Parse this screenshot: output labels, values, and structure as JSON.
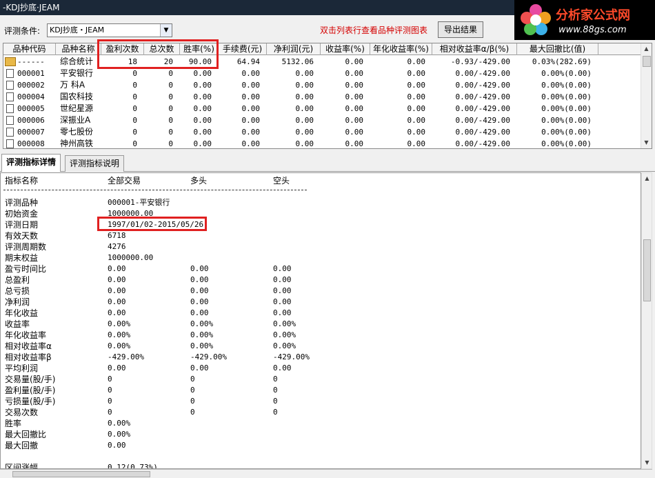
{
  "window": {
    "title": "-KDJ抄底·JEAM"
  },
  "logo": {
    "brand": "分析家公式网",
    "site": "www.88gs.com"
  },
  "toolbar": {
    "condition_label": "评测条件:",
    "condition_value": "KDJ抄底・JEAM",
    "hint": "双击列表行查看品种评测图表",
    "export_label": "导出结果"
  },
  "grid": {
    "columns": [
      "品种代码",
      "品种名称",
      "盈利次数",
      "总次数",
      "胜率(%)",
      "手续费(元)",
      "净利润(元)",
      "收益率(%)",
      "年化收益率(%)",
      "相对收益率α/β(%)",
      "最大回撤比(值)"
    ],
    "rows": [
      [
        "------",
        "综合统计",
        "18",
        "20",
        "90.00",
        "64.94",
        "5132.06",
        "0.00",
        "0.00",
        "-0.93/-429.00",
        "0.03%(282.69)"
      ],
      [
        "000001",
        "平安银行",
        "0",
        "0",
        "0.00",
        "0.00",
        "0.00",
        "0.00",
        "0.00",
        "0.00/-429.00",
        "0.00%(0.00)"
      ],
      [
        "000002",
        "万  科A",
        "0",
        "0",
        "0.00",
        "0.00",
        "0.00",
        "0.00",
        "0.00",
        "0.00/-429.00",
        "0.00%(0.00)"
      ],
      [
        "000004",
        "国农科技",
        "0",
        "0",
        "0.00",
        "0.00",
        "0.00",
        "0.00",
        "0.00",
        "0.00/-429.00",
        "0.00%(0.00)"
      ],
      [
        "000005",
        "世纪星源",
        "0",
        "0",
        "0.00",
        "0.00",
        "0.00",
        "0.00",
        "0.00",
        "0.00/-429.00",
        "0.00%(0.00)"
      ],
      [
        "000006",
        "深振业A",
        "0",
        "0",
        "0.00",
        "0.00",
        "0.00",
        "0.00",
        "0.00",
        "0.00/-429.00",
        "0.00%(0.00)"
      ],
      [
        "000007",
        "零七股份",
        "0",
        "0",
        "0.00",
        "0.00",
        "0.00",
        "0.00",
        "0.00",
        "0.00/-429.00",
        "0.00%(0.00)"
      ],
      [
        "000008",
        "神州高铁",
        "0",
        "0",
        "0.00",
        "0.00",
        "0.00",
        "0.00",
        "0.00",
        "0.00/-429.00",
        "0.00%(0.00)"
      ]
    ]
  },
  "tabs": [
    "评测指标详情",
    "评测指标说明"
  ],
  "detail": {
    "header": [
      "指标名称",
      "全部交易",
      "多头",
      "空头"
    ],
    "rows": [
      [
        "评测品种",
        "000001-平安银行",
        "",
        ""
      ],
      [
        "初始资金",
        "1000000.00",
        "",
        ""
      ],
      [
        "评测日期",
        "1997/01/02-2015/05/26",
        "",
        ""
      ],
      [
        "有效天数",
        "6718",
        "",
        ""
      ],
      [
        "评测周期数",
        "4276",
        "",
        ""
      ],
      [
        "期末权益",
        "1000000.00",
        "",
        ""
      ],
      [
        "盈亏时间比",
        "0.00",
        "0.00",
        "0.00"
      ],
      [
        "总盈利",
        "0.00",
        "0.00",
        "0.00"
      ],
      [
        "总亏损",
        "0.00",
        "0.00",
        "0.00"
      ],
      [
        "净利润",
        "0.00",
        "0.00",
        "0.00"
      ],
      [
        "年化收益",
        "0.00",
        "0.00",
        "0.00"
      ],
      [
        "收益率",
        "0.00%",
        "0.00%",
        "0.00%"
      ],
      [
        "年化收益率",
        "0.00%",
        "0.00%",
        "0.00%"
      ],
      [
        "相对收益率α",
        "0.00%",
        "0.00%",
        "0.00%"
      ],
      [
        "相对收益率β",
        "-429.00%",
        "-429.00%",
        "-429.00%"
      ],
      [
        "平均利润",
        "0.00",
        "0.00",
        "0.00"
      ],
      [
        "交易量(股/手)",
        "0",
        "0",
        "0"
      ],
      [
        "盈利量(股/手)",
        "0",
        "0",
        "0"
      ],
      [
        "亏损量(股/手)",
        "0",
        "0",
        "0"
      ],
      [
        "交易次数",
        "0",
        "0",
        "0"
      ],
      [
        "胜率",
        "0.00%",
        "",
        ""
      ],
      [
        "最大回撤比",
        "0.00%",
        "",
        ""
      ],
      [
        "最大回撤",
        "0.00",
        "",
        ""
      ],
      [
        "",
        "",
        "",
        ""
      ],
      [
        "区间涨幅",
        "0.12(0.73%)",
        "",
        ""
      ]
    ]
  }
}
